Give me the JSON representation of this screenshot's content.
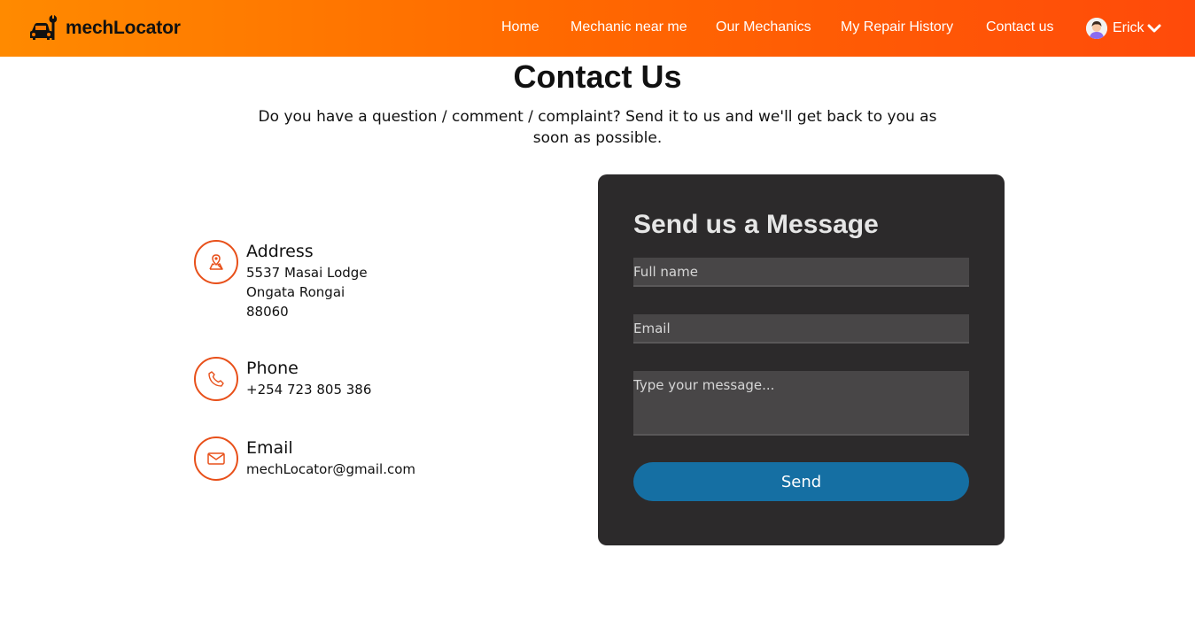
{
  "brand": {
    "name": "mechLocator",
    "logo_icon": "mechanic-car-wrench-icon"
  },
  "nav": {
    "items": [
      {
        "label": "Home"
      },
      {
        "label": "Mechanic near me"
      },
      {
        "label": "Our Mechanics"
      },
      {
        "label": "My Repair History"
      },
      {
        "label": "Contact us"
      }
    ],
    "user": {
      "name": "Erick",
      "avatar_icon": "user-avatar-icon",
      "dropdown_icon": "chevron-down-icon"
    }
  },
  "page": {
    "title": "Contact Us",
    "subtitle": "Do you have a question / comment / complaint? Send it to us and we'll get back to you as soon as possible."
  },
  "contact": {
    "address": {
      "title": "Address",
      "lines": [
        "5537 Masai Lodge",
        "Ongata Rongai",
        "88060"
      ],
      "icon": "map-pin-icon"
    },
    "phone": {
      "title": "Phone",
      "value": "+254 723 805 386",
      "icon": "phone-icon"
    },
    "email": {
      "title": "Email",
      "value": "mechLocator@gmail.com",
      "icon": "mail-icon"
    }
  },
  "form": {
    "title": "Send us a Message",
    "name_placeholder": "Full name",
    "email_placeholder": "Email",
    "message_placeholder": "Type your message...",
    "send_label": "Send"
  },
  "colors": {
    "nav_gradient_start": "#ff8a00",
    "nav_gradient_end": "#ff4a0a",
    "accent": "#e8501a",
    "card_bg": "#2c2a2b",
    "button": "#156fa3"
  }
}
